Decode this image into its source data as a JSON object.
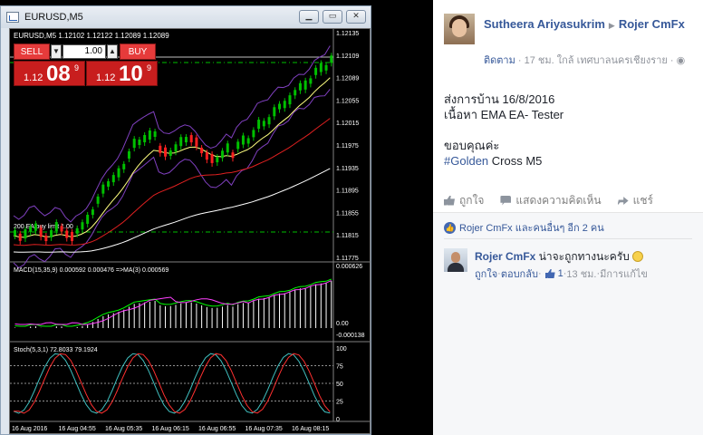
{
  "mt4": {
    "window_title": "EURUSD,M5",
    "min_glyph": "▁",
    "max_glyph": "▭",
    "close_glyph": "✕",
    "chart_header": "EURUSD,M5  1.12102 1.12122 1.12089 1.12089",
    "trade": {
      "sell_label": "SELL",
      "buy_label": "BUY",
      "lot": "1.00",
      "dec_glyph": "▼",
      "inc_glyph": "▲",
      "sell_price_prefix": "1.12",
      "sell_price_big": "08",
      "sell_price_sup": "9",
      "buy_price_prefix": "1.12",
      "buy_price_big": "10",
      "buy_price_sup": "9"
    },
    "order_label": "200 EA buy limit 1.00",
    "price_scale": [
      "1.12135",
      "1.12109",
      "1.12089",
      "1.12055",
      "1.12015",
      "1.11975",
      "1.11935",
      "1.11895",
      "1.11855",
      "1.11815",
      "1.11775"
    ],
    "macd_label": "MACD(15,35,9) 0.000592 0.000476 =>MA(3) 0.000569",
    "macd_scale": [
      "0.000626",
      "0.00",
      "-0.000138"
    ],
    "stoch_label": "Stoch(5,3,1) 72.8033 79.1924",
    "stoch_scale": [
      "100",
      "75",
      "50",
      "25",
      "0"
    ],
    "time_labels": [
      "16 Aug 2016",
      "16 Aug 04:55",
      "16 Aug 05:35",
      "16 Aug 06:15",
      "16 Aug 06:55",
      "16 Aug 07:35",
      "16 Aug 08:15"
    ],
    "colors": {
      "bull": "#00c000",
      "bear": "#ff2020",
      "ema_fast": "#ffff80",
      "ema_mid": "#e02020",
      "ema_slow": "#ffffff",
      "bands": "#8040c0",
      "macd_hist": "#ffffff",
      "macd_sig": "#00ff00",
      "stoch_main": "#40c0c0",
      "stoch_sig": "#ff3030"
    }
  },
  "facebook": {
    "poster_name": "Sutheera Ariyasukrim",
    "poster_arrow": "▶",
    "poster_target": "Rojer CmFx",
    "follow_label": "ติดตาม",
    "post_time": " · 17 ชม. ใกล้ เทศบาลนครเชียงราย · ",
    "globe_glyph": "◉",
    "body_line1": "ส่งการบ้าน 16/8/2016",
    "body_line2": "เนื้อหา EMA EA- Tester",
    "body_line3": "ขอบคุณค่ะ",
    "hashtag": "#Golden",
    "body_line4_rest": " Cross M5",
    "like_label": "ถูกใจ",
    "comment_label": "แสดงความคิดเห็น",
    "share_label": "แชร์",
    "likes_badge_glyph": "👍",
    "likes_text": "Rojer CmFx และคนอื่นๆ อีก 2 คน",
    "comment_author": "Rojer CmFx",
    "comment_text": " น่าจะถูกทางนะครับ",
    "comment_like": "ถูกใจ",
    "comment_reply": "ตอบกลับ",
    "comment_like_count": "1",
    "comment_time": "13 ชม.",
    "comment_edited": "มีการแก้ไข",
    "dot": " · "
  }
}
